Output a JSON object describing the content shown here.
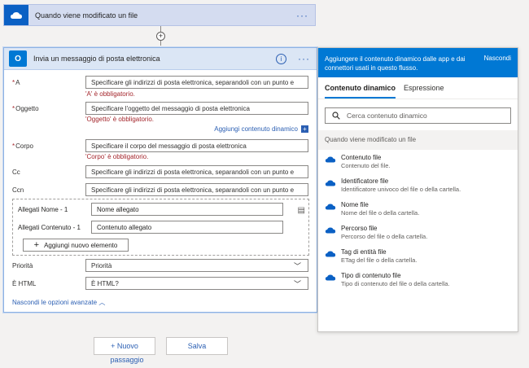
{
  "trigger": {
    "title": "Quando viene modificato un file",
    "more": "···"
  },
  "connector": {
    "plus": "+"
  },
  "action": {
    "title": "Invia un messaggio di posta elettronica",
    "info": "i",
    "more": "···",
    "fields": {
      "to": {
        "label": "A",
        "placeholder": "Specificare gli indirizzi di posta elettronica, separandoli con un punto e",
        "error": "'A' è obbligatorio."
      },
      "subject": {
        "label": "Oggetto",
        "placeholder": "Specificare l'oggetto del messaggio di posta elettronica",
        "error": "'Oggetto' è obbligatorio."
      },
      "add_dynamic": "Aggiungi contenuto dinamico",
      "body": {
        "label": "Corpo",
        "placeholder": "Specificare il corpo del messaggio di posta elettronica",
        "error": "'Corpo' è obbligatorio."
      },
      "cc": {
        "label": "Cc",
        "placeholder": "Specificare gli indirizzi di posta elettronica, separandoli con un punto e"
      },
      "bcc": {
        "label": "Ccn",
        "placeholder": "Specificare gli indirizzi di posta elettronica, separandoli con un punto e"
      }
    },
    "attachments": {
      "name_label": "Allegati Nome - 1",
      "name_placeholder": "Nome allegato",
      "content_label": "Allegati Contenuto - 1",
      "content_placeholder": "Contenuto allegato",
      "add_item": "Aggiungi nuovo elemento"
    },
    "priority": {
      "label": "Priorità",
      "value": "Priorità"
    },
    "is_html": {
      "label": "È HTML",
      "value": "È HTML?"
    },
    "hide_advanced": "Nascondi le opzioni avanzate"
  },
  "footer": {
    "new_step": "+ Nuovo",
    "new_step_sub": "passaggio",
    "save": "Salva"
  },
  "panel": {
    "header_text": "Aggiungere il contenuto dinamico dalle app e dai connettori usati in questo flusso.",
    "hide": "Nascondi",
    "tabs": [
      "Contenuto dinamico",
      "Espressione"
    ],
    "search_placeholder": "Cerca contenuto dinamico",
    "section": "Quando viene modificato un file",
    "items": [
      {
        "title": "Contenuto file",
        "desc": "Contenuto del file."
      },
      {
        "title": "Identificatore file",
        "desc": "Identificatore univoco del file o della cartella."
      },
      {
        "title": "Nome file",
        "desc": "Nome del file o della cartella."
      },
      {
        "title": "Percorso file",
        "desc": "Percorso del file o della cartella."
      },
      {
        "title": "Tag di entità file",
        "desc": "ETag del file o della cartella."
      },
      {
        "title": "Tipo di contenuto file",
        "desc": "Tipo di contenuto del file o della cartella."
      }
    ]
  },
  "colors": {
    "accent": "#0078d4",
    "error": "#a4262c",
    "link": "#2b5fb3"
  }
}
